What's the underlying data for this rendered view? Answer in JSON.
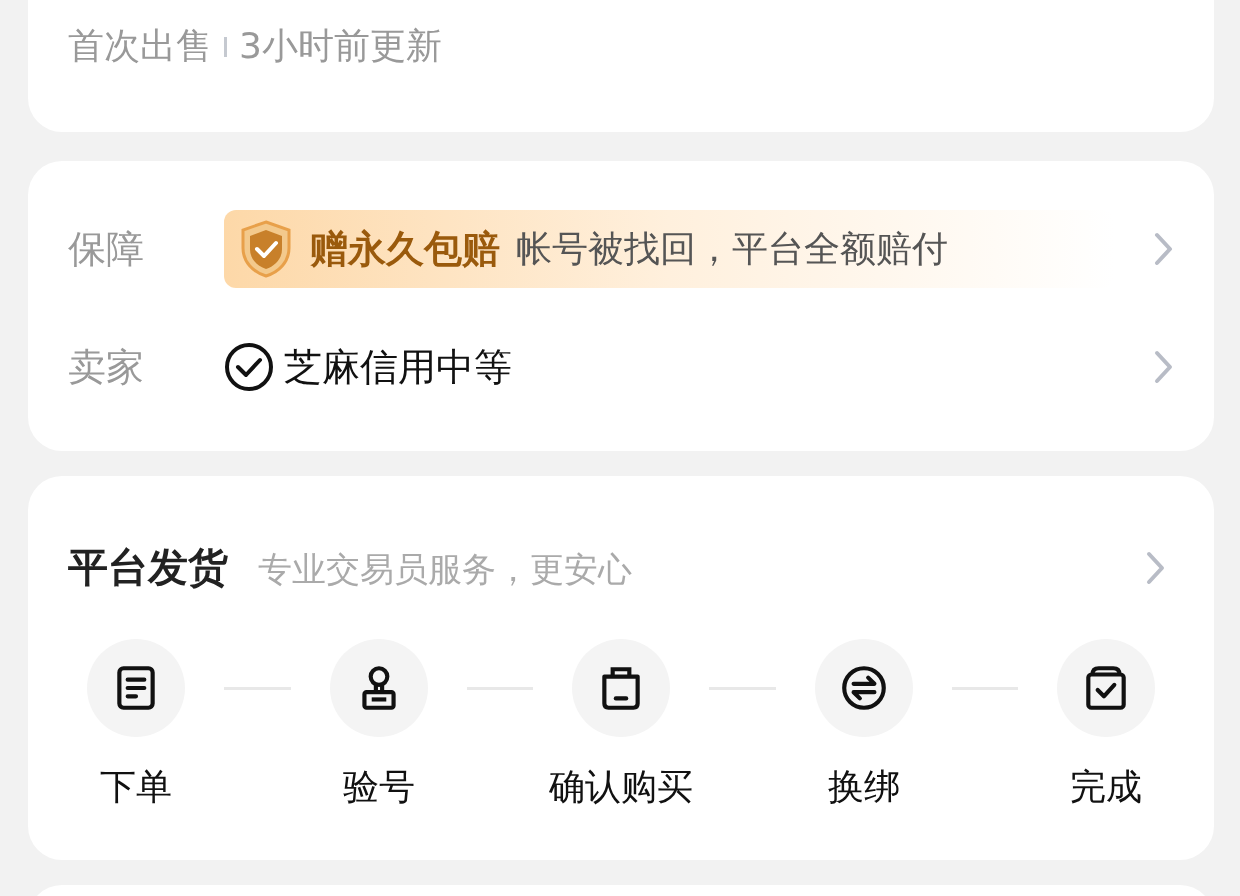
{
  "listing_meta": {
    "status": "首次出售",
    "updated": "3小时前更新"
  },
  "details": [
    {
      "kind": "guarantee",
      "label": "保障",
      "badge": "赠永久包赔",
      "text": "帐号被找回，平台全额赔付"
    },
    {
      "kind": "seller",
      "label": "卖家",
      "text": "芝麻信用中等"
    }
  ],
  "delivery": {
    "title": "平台发货",
    "subtitle": "专业交易员服务，更安心",
    "steps": [
      {
        "kind": "order",
        "label": "下单"
      },
      {
        "kind": "verify",
        "label": "验号"
      },
      {
        "kind": "purchase",
        "label": "确认购买"
      },
      {
        "kind": "rebind",
        "label": "换绑"
      },
      {
        "kind": "done",
        "label": "完成"
      }
    ]
  }
}
